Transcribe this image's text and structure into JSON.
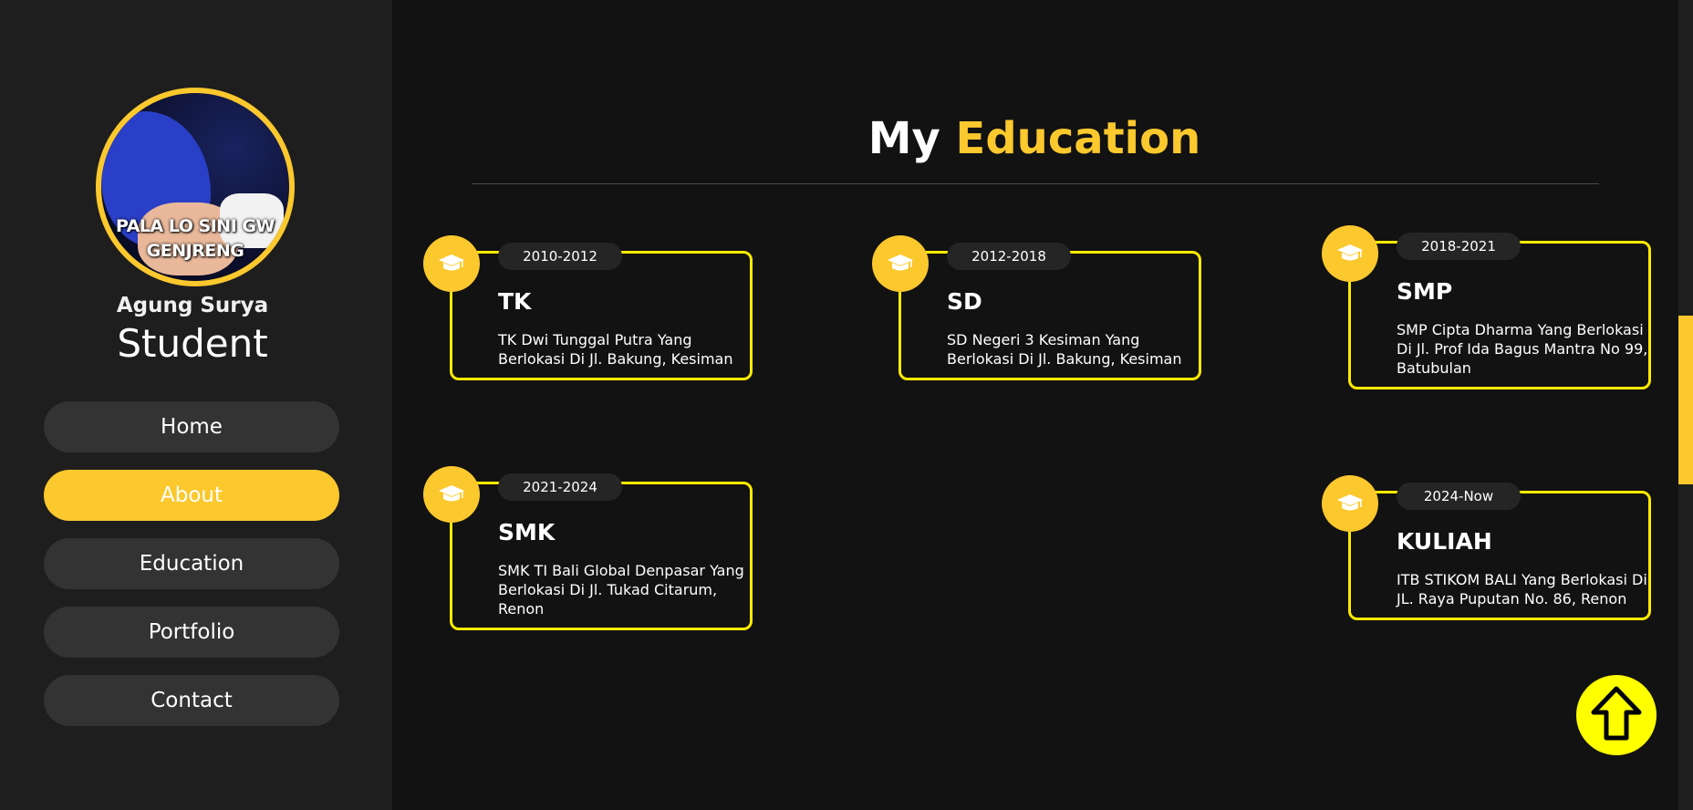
{
  "profile": {
    "name": "Agung Surya",
    "role": "Student",
    "avatar_caption_line1": "PALA LO SINI GW",
    "avatar_caption_line2": "GENJRENG"
  },
  "nav": {
    "items": [
      {
        "label": "Home",
        "active": false
      },
      {
        "label": "About",
        "active": true
      },
      {
        "label": "Education",
        "active": false
      },
      {
        "label": "Portfolio",
        "active": false
      },
      {
        "label": "Contact",
        "active": false
      }
    ]
  },
  "section": {
    "title_prefix": "My",
    "title_accent": "Education"
  },
  "education": [
    {
      "years": "2010-2012",
      "school": "TK",
      "description": "TK Dwi Tunggal Putra Yang Berlokasi Di Jl. Bakung, Kesiman"
    },
    {
      "years": "2012-2018",
      "school": "SD",
      "description": "SD Negeri 3 Kesiman Yang Berlokasi Di Jl. Bakung, Kesiman"
    },
    {
      "years": "2018-2021",
      "school": "SMP",
      "description": "SMP Cipta Dharma Yang Berlokasi Di Jl. Prof Ida Bagus Mantra No 99, Batubulan"
    },
    {
      "years": "2021-2024",
      "school": "SMK",
      "description": "SMK TI Bali Global Denpasar Yang Berlokasi Di Jl. Tukad Citarum, Renon"
    },
    {
      "years": "2024-Now",
      "school": "KULIAH",
      "description": "ITB STIKOM BALI Yang Berlokasi Di JL. Raya Puputan No. 86, Renon"
    }
  ],
  "icons": {
    "education": "graduation-cap-icon",
    "back_to_top": "arrow-up-icon"
  },
  "colors": {
    "accent": "#fbc82d",
    "card_border": "#ffea00",
    "background": "#121212",
    "sidebar": "#1e1e1e",
    "nav_button": "#333333"
  }
}
